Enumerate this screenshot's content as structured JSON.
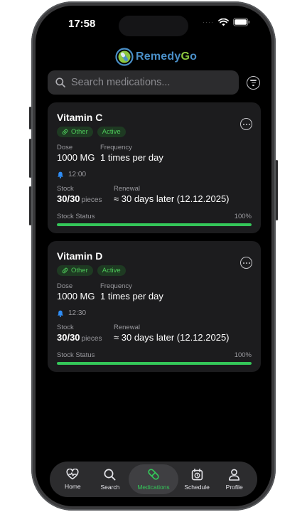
{
  "status_bar": {
    "time": "17:58",
    "dots": "····"
  },
  "app": {
    "logo_part1": "Remedy",
    "logo_part2": "G",
    "logo_part3": "o"
  },
  "search": {
    "placeholder": "Search medications..."
  },
  "medications": [
    {
      "name": "Vitamin C",
      "category": "Other",
      "status": "Active",
      "dose_label": "Dose",
      "dose": "1000 MG",
      "frequency_label": "Frequency",
      "frequency": "1 times per day",
      "reminder_time": "12:00",
      "stock_label": "Stock",
      "stock": "30/30",
      "stock_unit": "pieces",
      "renewal_label": "Renewal",
      "renewal": "≈ 30 days later (12.12.2025)",
      "stock_status_label": "Stock Status",
      "stock_percent": "100%",
      "stock_fraction": 1.0
    },
    {
      "name": "Vitamin D",
      "category": "Other",
      "status": "Active",
      "dose_label": "Dose",
      "dose": "1000 MG",
      "frequency_label": "Frequency",
      "frequency": "1 times per day",
      "reminder_time": "12:30",
      "stock_label": "Stock",
      "stock": "30/30",
      "stock_unit": "pieces",
      "renewal_label": "Renewal",
      "renewal": "≈ 30 days later (12.12.2025)",
      "stock_status_label": "Stock Status",
      "stock_percent": "100%",
      "stock_fraction": 1.0
    }
  ],
  "tabs": [
    {
      "label": "Home",
      "icon": "heart-pulse-icon"
    },
    {
      "label": "Search",
      "icon": "search-icon"
    },
    {
      "label": "Medications",
      "icon": "pill-icon",
      "active": true
    },
    {
      "label": "Schedule",
      "icon": "calendar-clock-icon"
    },
    {
      "label": "Profile",
      "icon": "person-icon"
    }
  ],
  "colors": {
    "accent": "#34c759",
    "background": "#000000",
    "card": "#1c1c1e",
    "logo_blue": "#4a8fc8",
    "logo_green": "#8cc63f"
  }
}
